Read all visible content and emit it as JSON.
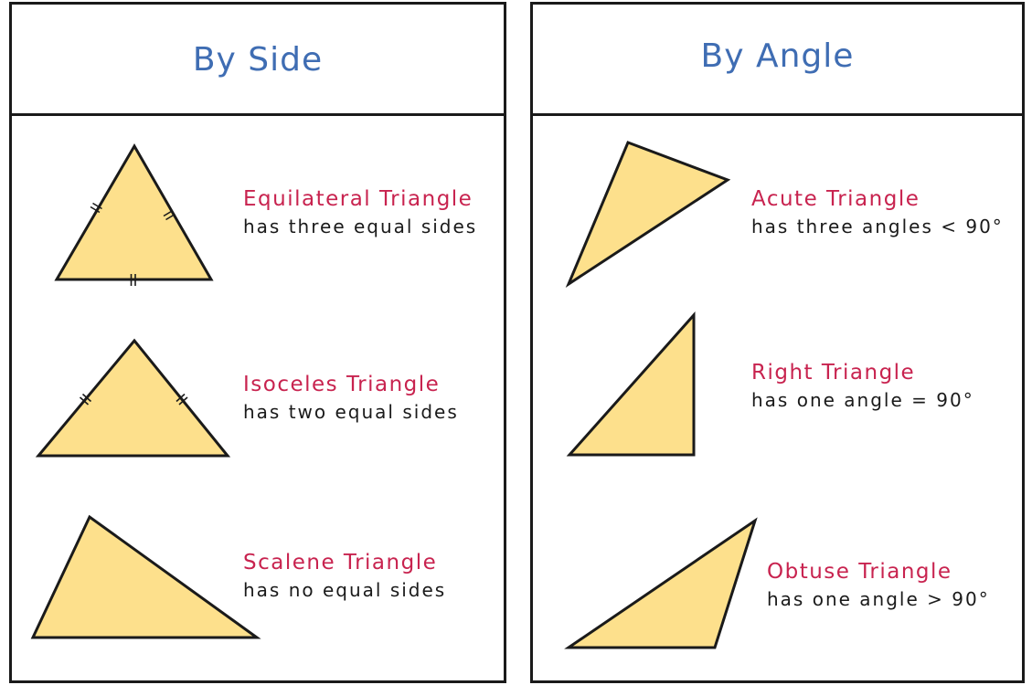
{
  "panels": {
    "by_side": {
      "title": "By Side",
      "items": [
        {
          "name": "Equilateral Triangle",
          "description": "has three equal sides"
        },
        {
          "name": "Isoceles Triangle",
          "description": "has two equal sides"
        },
        {
          "name": "Scalene Triangle",
          "description": "has no equal sides"
        }
      ]
    },
    "by_angle": {
      "title": "By Angle",
      "items": [
        {
          "name": "Acute Triangle",
          "description": "has three angles < 90°"
        },
        {
          "name": "Right Triangle",
          "description": "has one angle =  90°"
        },
        {
          "name": "Obtuse Triangle",
          "description": "has one angle > 90°"
        }
      ]
    }
  },
  "colors": {
    "title": "#3f6db3",
    "name": "#c8234f",
    "triangle_fill": "#fde08c",
    "stroke": "#1a1a1a"
  }
}
